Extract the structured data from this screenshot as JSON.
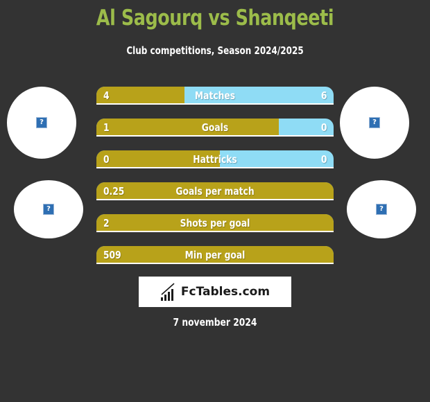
{
  "header": {
    "title": "Al Sagourq vs Shanqeeti",
    "subtitle": "Club competitions, Season 2024/2025"
  },
  "colors": {
    "background": "#333333",
    "title": "#9cbc4a",
    "left_bar": "#b8a21a",
    "right_bar": "#8fdcf5"
  },
  "avatars": {
    "team_left": {
      "icon": "broken-image-icon",
      "glyph": "?"
    },
    "team_right": {
      "icon": "broken-image-icon",
      "glyph": "?"
    },
    "player_left": {
      "icon": "broken-image-icon",
      "glyph": "?"
    },
    "player_right": {
      "icon": "broken-image-icon",
      "glyph": "?"
    }
  },
  "stats": [
    {
      "label": "Matches",
      "left": "4",
      "right": "6",
      "left_share": 0.37
    },
    {
      "label": "Goals",
      "left": "1",
      "right": "0",
      "left_share": 0.77
    },
    {
      "label": "Hattricks",
      "left": "0",
      "right": "0",
      "left_share": 0.52
    },
    {
      "label": "Goals per match",
      "left": "0.25",
      "right": "",
      "left_share": 1.0
    },
    {
      "label": "Shots per goal",
      "left": "2",
      "right": "",
      "left_share": 1.0
    },
    {
      "label": "Min per goal",
      "left": "509",
      "right": "",
      "left_share": 1.0
    }
  ],
  "logo": {
    "text": "FcTables.com",
    "icon": "bar-chart-icon"
  },
  "date": "7 november 2024"
}
